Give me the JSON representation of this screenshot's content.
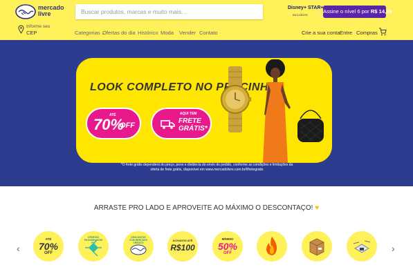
{
  "header": {
    "logo_text_line1": "mercado",
    "logo_text_line2": "livre",
    "search_placeholder": "Buscar produtos, marcas e muito mais…",
    "disney_logo": "Disney+ STAR+",
    "disney_sub": "INCLUÍDOS",
    "promo_text": "Assine o nível 6 por",
    "promo_price": "R$ 14,99",
    "location_line1": "Informe seu",
    "location_line2": "CEP",
    "nav": [
      "Categorias",
      "Ofertas do dia",
      "Histórico",
      "Moda",
      "Vender",
      "Contato"
    ],
    "user_links": [
      "Crie a sua conta",
      "Entre",
      "Compras"
    ],
    "colors": {
      "header_bg": "#fff159",
      "brand_blue": "#2d3277",
      "promo_purple": "#5a25a6"
    }
  },
  "hero": {
    "title": "LOOK COMPLETO NO PRECINHO!",
    "pill1": {
      "top": "ATÉ",
      "big": "70%",
      "suffix": "OFF"
    },
    "pill2": {
      "top": "AQUI TEM",
      "line1": "FRETE",
      "line2": "GRÁTIS*"
    },
    "note": "*O frete grátis dependerá do preço, peso e distância do envio do pedido, conforme as condições e limitações da oferta de frete grátis, disponível em www.mercadolivre.com.br/l/fretegratis",
    "colors": {
      "bg": "#2d3c8f",
      "card": "#ffe600",
      "pill": "#e8198b"
    }
  },
  "carousel": {
    "title": "ARRASTE PRO LADO E APROVEITE AO MÁXIMO O DESCONTAÇO!",
    "prev_icon": "chevron-left-icon",
    "next_icon": "chevron-right-icon",
    "items": [
      {
        "name": "ate-70-off",
        "top": "ATÉ",
        "big": "70%",
        "suffix": "OFF"
      },
      {
        "name": "ofertas-pagando-com-pix",
        "top": "OFERTAS PAGANDO COM PIX",
        "icon": "pix-icon"
      },
      {
        "name": "descontos-mercado-credito",
        "top": "DESCONTOS COM MERCADO CRÉDITO",
        "icon": "handshake-icon"
      },
      {
        "name": "achados-ate-100",
        "top": "ACHADOS ATÉ",
        "big": "R$100"
      },
      {
        "name": "minimo-50-off",
        "top": "MÍNIMO",
        "big": "50%",
        "suffix": "OFF"
      },
      {
        "name": "fire",
        "icon": "fire-icon"
      },
      {
        "name": "box",
        "icon": "box-icon"
      },
      {
        "name": "drone",
        "icon": "drone-icon"
      }
    ]
  }
}
